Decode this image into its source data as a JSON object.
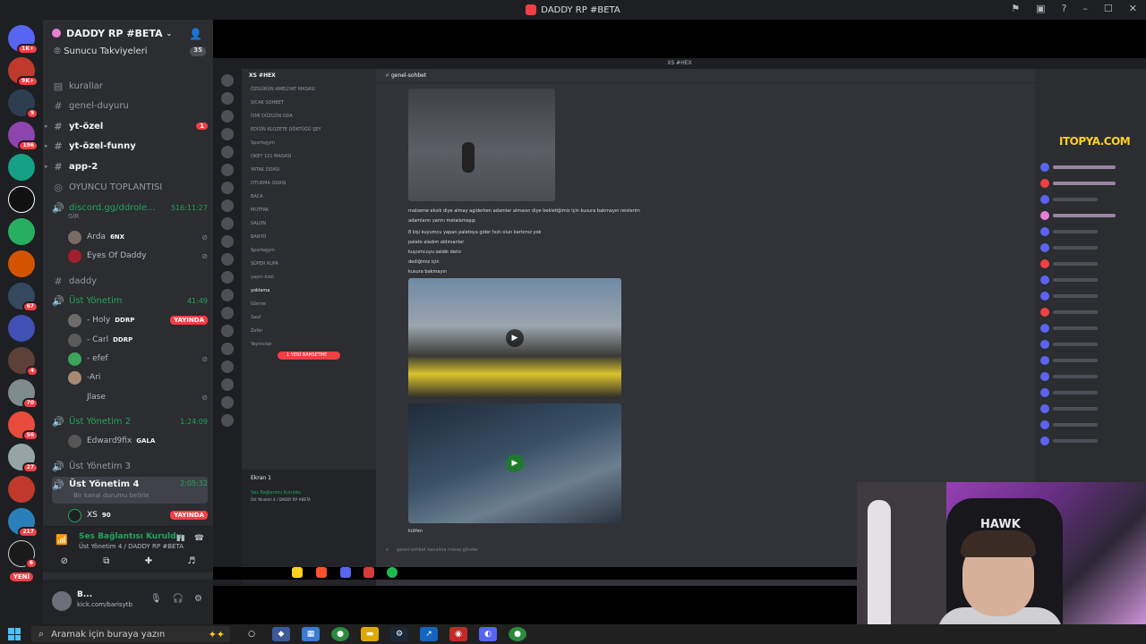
{
  "window": {
    "title": "DADDY RP #BETA"
  },
  "server": {
    "name": "DADDY RP #BETA",
    "boost_label": "Sunucu Takviyeleri",
    "boost_count": "35"
  },
  "rail": {
    "badges": [
      "1K+",
      "9K+",
      "9",
      "196",
      "",
      "",
      "",
      "",
      "67",
      "",
      "4",
      "70",
      "56",
      "27",
      "",
      "217",
      "6"
    ],
    "new_label": "YENİ"
  },
  "channels": [
    {
      "name": "kurallar",
      "type": "text"
    },
    {
      "name": "genel-duyuru",
      "type": "text"
    },
    {
      "name": "yt-özel",
      "type": "text",
      "bold": true,
      "unread": "1"
    },
    {
      "name": "yt-özel-funny",
      "type": "text",
      "bold": true
    },
    {
      "name": "app-2",
      "type": "text",
      "bold": true
    },
    {
      "name": "OYUNCU TOPLANTISI",
      "type": "stage"
    },
    {
      "name": "discord.gg/ddrole...",
      "type": "voice",
      "timer": "516:11:27"
    }
  ],
  "discord_voice": {
    "users": [
      {
        "name": "Arda",
        "tag": "6NX"
      },
      {
        "name": "Eyes Of Daddy",
        "tag": ""
      }
    ],
    "subtext": "GİR"
  },
  "daddy_channel": "daddy",
  "ust_yonetim": {
    "name": "Üst Yönetim",
    "timer": "41:49",
    "users": [
      {
        "name": "- Holy",
        "tag": "DDRP",
        "live": "YAYINDA"
      },
      {
        "name": "- Carl",
        "tag": "DDRP",
        "live": ""
      },
      {
        "name": "- efef",
        "tag": "",
        "live": ""
      },
      {
        "name": "-Ari",
        "tag": "",
        "live": ""
      },
      {
        "name": "Jlase",
        "tag": "",
        "live": ""
      }
    ]
  },
  "ust_yonetim_2": {
    "name": "Üst Yönetim 2",
    "timer": "1:24:09",
    "user": "Edward9fix",
    "tag": "GALA"
  },
  "ust_yonetim_3": {
    "name": "Üst Yönetim 3"
  },
  "ust_yonetim_4": {
    "name": "Üst Yönetim 4",
    "timer": "2:05:32",
    "status": "Bir kanal durumu belirle",
    "user": "XS",
    "tag": "90",
    "live": "YAYINDA"
  },
  "voice_status": {
    "title": "Ses Bağlantısı Kuruldu",
    "subtitle": "Üst Yönetim 4 / DADDY RP #BETA"
  },
  "user_panel": {
    "name": "B...",
    "status": "kick.com/barisytb"
  },
  "stream": {
    "inner_title": "XS #HEX",
    "server_name": "XS #HEX",
    "channel": "genel-sohbet",
    "watermark": "ITOPYA.COM",
    "messages": [
      "malzeme eksik diye almay agiderken adamlar almasın diye bekletiğimiz için kusura bakmayın reislerim",
      "adamların yarını metalamaşıp",
      "8 kişi kuyumcu yapan paletoya gider hızlı olun kartımız yok",
      "palato aladım aldırsanlar",
      "kuyumcuyu saldık deriz",
      "dediğimiz için",
      "kusura bakmayın",
      "kütfen"
    ],
    "input_placeholder": "genel-sohbet kanalına mesaj gönder",
    "screen_label": "Ekran 1",
    "inner_voice": "Ses Bağlantısı Kuruldu",
    "inner_voice_sub": "Üst Yönetim 4 / DADDY RP #BETA",
    "new_msg": "1 YENİ BAHSETME",
    "inner_channels": [
      "ÖZGÜRÜN AMELİYAT MASASI",
      "SICAK SOHBET",
      "İSMİ DÜZGÜN ODA",
      "EDİSİN KLOZETE DÖKTÜĞÜ ŞEY",
      "Sportsgym",
      "OKEY 101 MASASI",
      "YATAK ODASI",
      "OTURMA ODASI",
      "BACA",
      "MUTFAK",
      "SALON",
      "BANYO",
      "Sportsgym",
      "SÜPER KUPA",
      "yayın-özel",
      "yoklama",
      "Görme",
      "Sauf",
      "Zefer",
      "Yayıncılar"
    ]
  },
  "taskbar": {
    "search_placeholder": "Aramak için buraya yazın"
  },
  "colors": {
    "accent_green": "#23a55a",
    "live_red": "#f23f43",
    "sidebar_bg": "#2b2d31"
  }
}
